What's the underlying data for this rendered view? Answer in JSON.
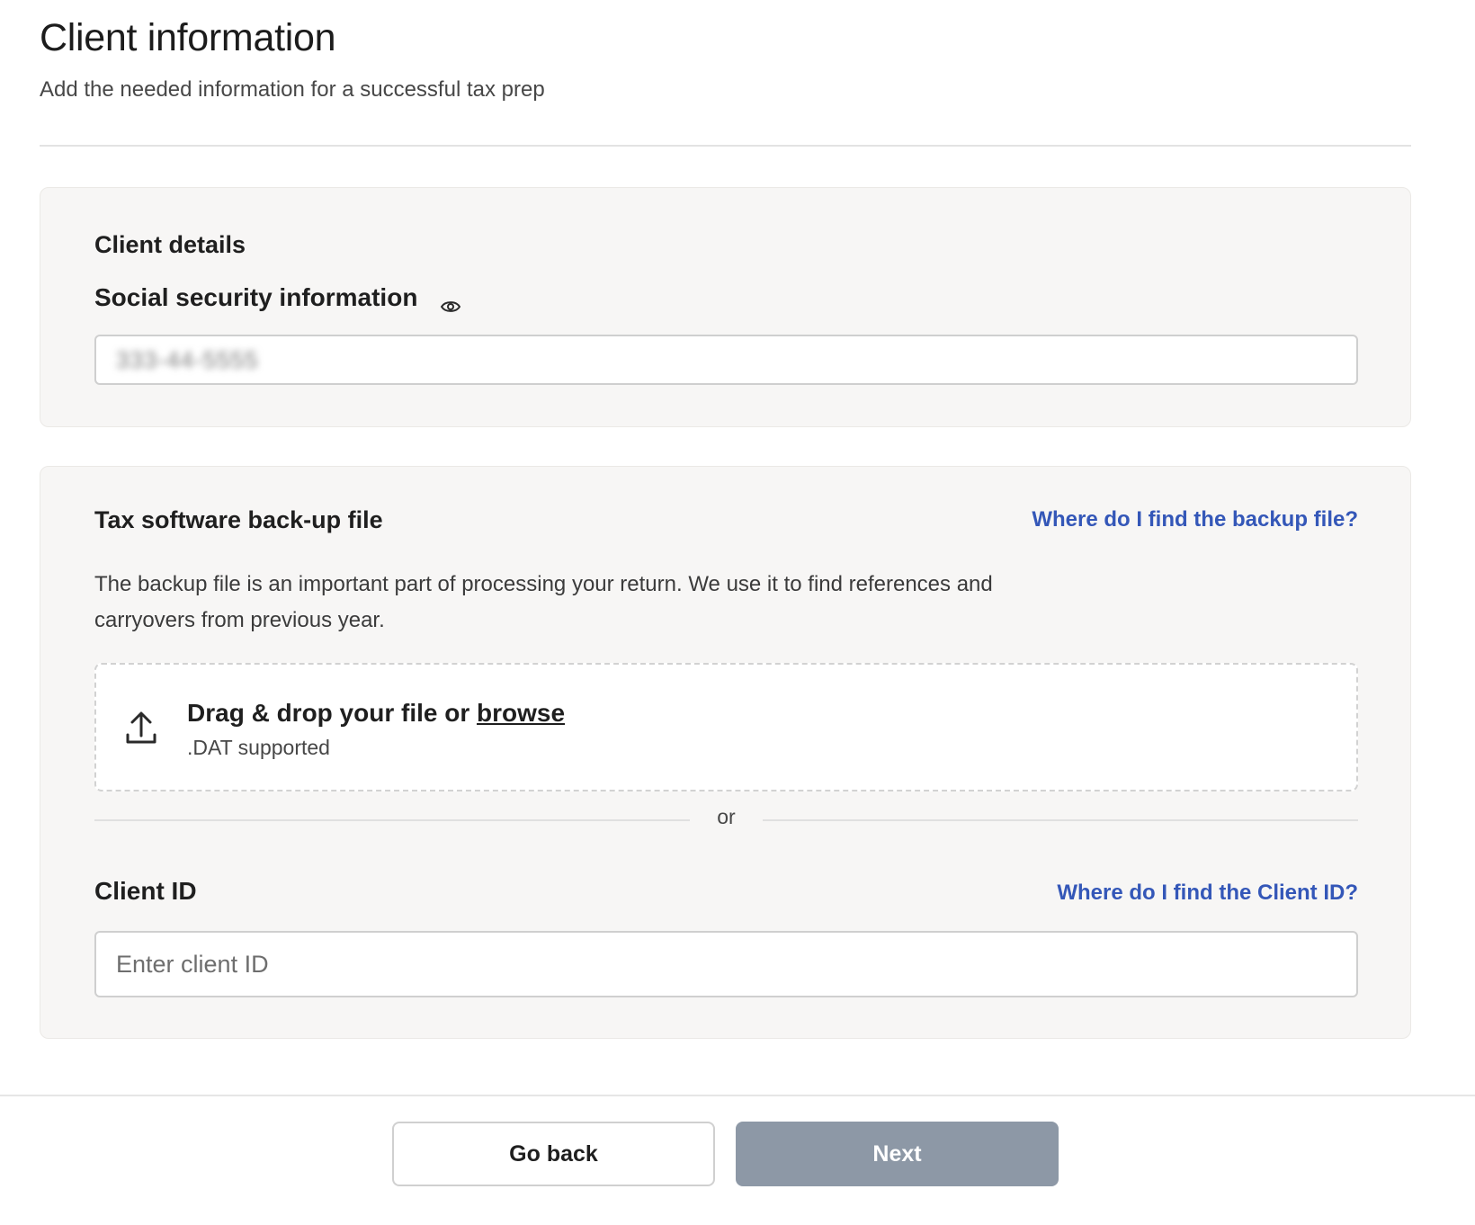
{
  "header": {
    "title": "Client information",
    "subtitle": "Add the needed information for a successful tax prep"
  },
  "client_details": {
    "section_title": "Client details",
    "ssn_label": "Social security information",
    "ssn_value": "333-44-5555",
    "ssn_value_blurred": true,
    "visibility_icon": "eye-icon"
  },
  "backup": {
    "section_title": "Tax software back-up file",
    "help_link": "Where do I find the backup file?",
    "description": "The backup file is an important part of processing your return. We use it to find references and carryovers from previous year.",
    "dropzone": {
      "icon": "upload-icon",
      "main_text": "Drag & drop your file or ",
      "browse_text": "browse",
      "supported_text": ".DAT supported"
    },
    "or_text": "or",
    "client_id_label": "Client ID",
    "client_id_help_link": "Where do I find the Client ID?",
    "client_id_placeholder": "Enter client ID",
    "client_id_value": ""
  },
  "footer": {
    "back_label": "Go back",
    "next_label": "Next"
  },
  "colors": {
    "link": "#3457b8",
    "card_bg": "#f7f6f5",
    "next_disabled_bg": "#8d98a6"
  }
}
